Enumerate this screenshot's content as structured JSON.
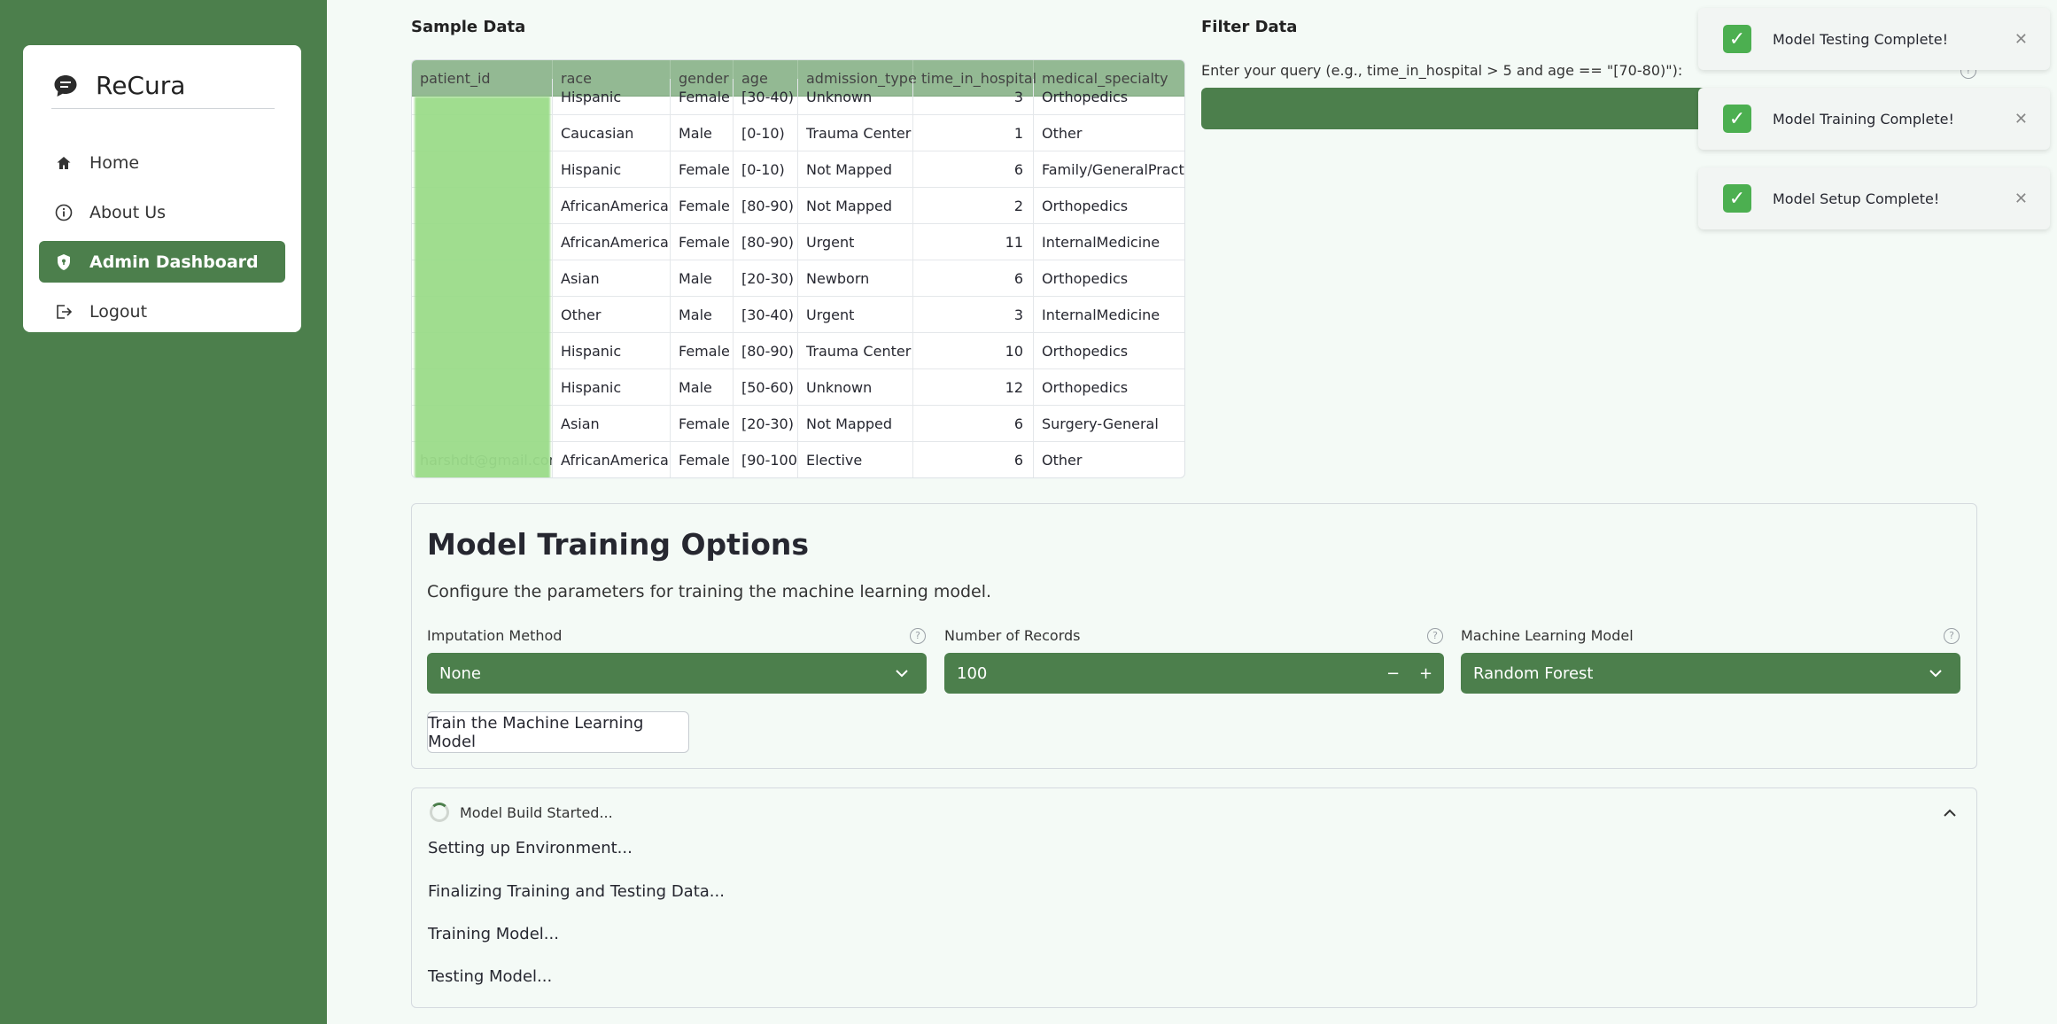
{
  "sidebar": {
    "brand": "ReCura",
    "items": [
      {
        "label": "Home",
        "icon": "home-icon"
      },
      {
        "label": "About Us",
        "icon": "info-icon"
      },
      {
        "label": "Admin Dashboard",
        "icon": "shield-icon",
        "active": true
      },
      {
        "label": "Logout",
        "icon": "logout-icon"
      }
    ]
  },
  "sample": {
    "title": "Sample Data",
    "columns": [
      "patient_id",
      "race",
      "gender",
      "age",
      "admission_type",
      "time_in_hospital",
      "medical_specialty"
    ],
    "rows": [
      [
        "",
        "Hispanic",
        "Female",
        "[30-40)",
        "Unknown",
        "3",
        "Orthopedics"
      ],
      [
        "",
        "Caucasian",
        "Male",
        "[0-10)",
        "Trauma Center",
        "1",
        "Other"
      ],
      [
        "",
        "Hispanic",
        "Female",
        "[0-10)",
        "Not Mapped",
        "6",
        "Family/GeneralPractice"
      ],
      [
        "",
        "AfricanAmerican",
        "Female",
        "[80-90)",
        "Not Mapped",
        "2",
        "Orthopedics"
      ],
      [
        "",
        "AfricanAmerican",
        "Female",
        "[80-90)",
        "Urgent",
        "11",
        "InternalMedicine"
      ],
      [
        "",
        "Asian",
        "Male",
        "[20-30)",
        "Newborn",
        "6",
        "Orthopedics"
      ],
      [
        "",
        "Other",
        "Male",
        "[30-40)",
        "Urgent",
        "3",
        "InternalMedicine"
      ],
      [
        "",
        "Hispanic",
        "Female",
        "[80-90)",
        "Trauma Center",
        "10",
        "Orthopedics"
      ],
      [
        "",
        "Hispanic",
        "Male",
        "[50-60)",
        "Unknown",
        "12",
        "Orthopedics"
      ],
      [
        "",
        "Asian",
        "Female",
        "[20-30)",
        "Not Mapped",
        "6",
        "Surgery-General"
      ],
      [
        "harshdt@gmail.com",
        "AfricanAmerican",
        "Female",
        "[90-100)",
        "Elective",
        "6",
        "Other"
      ]
    ]
  },
  "filter": {
    "title": "Filter Data",
    "label": "Enter your query (e.g., time_in_hospital > 5 and age == \"[70-80)\"):",
    "value": ""
  },
  "toasts": [
    {
      "message": "Model Testing Complete!"
    },
    {
      "message": "Model Training Complete!"
    },
    {
      "message": "Model Setup Complete!"
    }
  ],
  "training": {
    "title": "Model Training Options",
    "description": "Configure the parameters for training the machine learning model.",
    "imputation": {
      "label": "Imputation Method",
      "value": "None"
    },
    "records": {
      "label": "Number of Records",
      "value": "100",
      "minus": "−",
      "plus": "+"
    },
    "model": {
      "label": "Machine Learning Model",
      "value": "Random Forest"
    },
    "button": "Train the Machine Learning Model"
  },
  "status": {
    "header": "Model Build Started...",
    "steps": [
      "Setting up Environment...",
      "Finalizing Training and Testing Data...",
      "Training Model...",
      "Testing Model..."
    ]
  },
  "colors": {
    "accent": "#4c7f4c",
    "header": "#93b993",
    "check": "#4caf50"
  }
}
